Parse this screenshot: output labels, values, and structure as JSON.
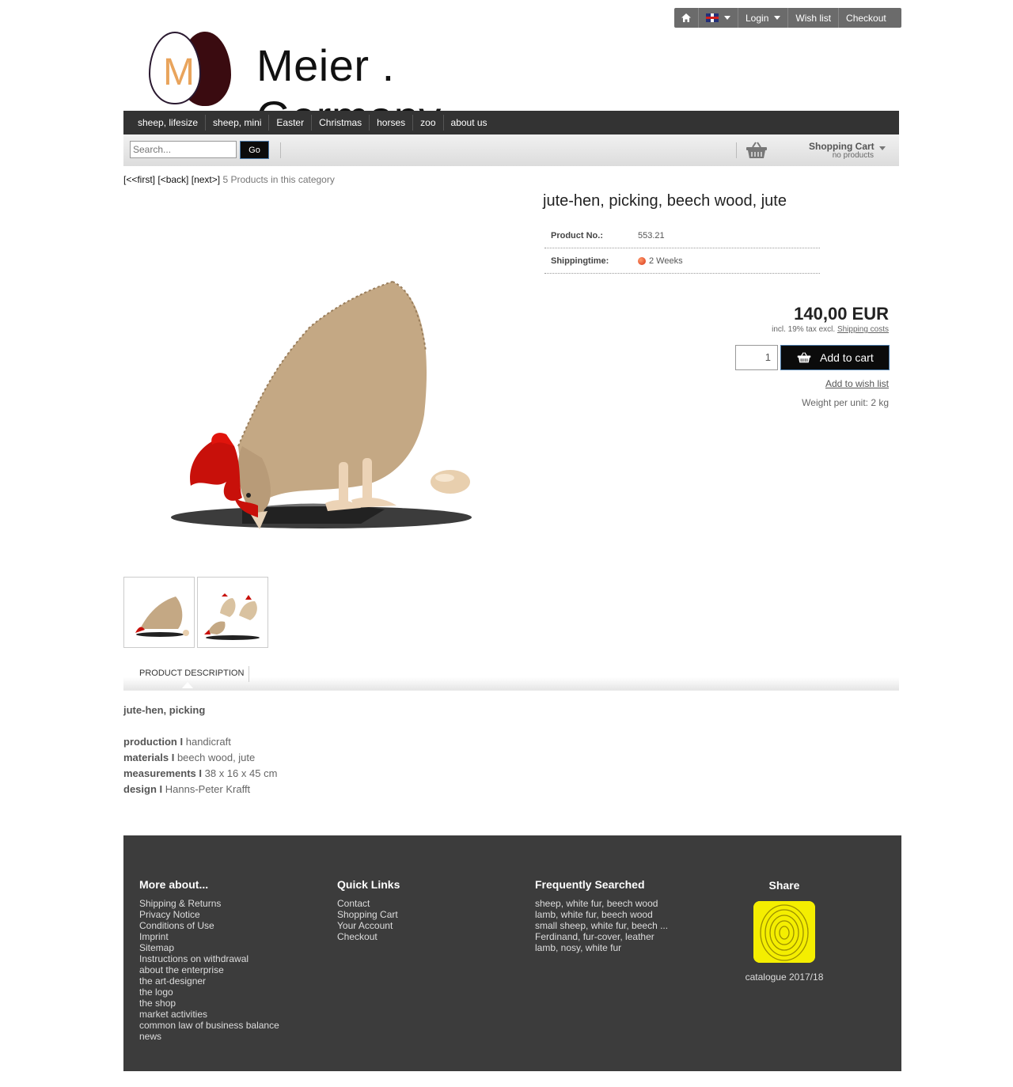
{
  "topbar": {
    "home_icon": "home-icon",
    "language_flag": "uk-flag-icon",
    "login": "Login",
    "wishlist": "Wish list",
    "checkout": "Checkout"
  },
  "logo": {
    "letter": "M",
    "text": "Meier . Germany"
  },
  "nav": [
    "sheep, lifesize",
    "sheep, mini",
    "Easter",
    "Christmas",
    "horses",
    "zoo",
    "about us"
  ],
  "search": {
    "placeholder": "Search...",
    "button": "Go"
  },
  "cart": {
    "title": "Shopping Cart",
    "status": "no products",
    "icon": "basket-icon"
  },
  "product_nav": {
    "first": "[<<first]",
    "back": "[<back]",
    "next": "[next>]",
    "count": "5 Products in this category"
  },
  "product": {
    "title": "jute-hen, picking, beech wood, jute",
    "number_label": "Product No.:",
    "number": "553.21",
    "shipping_label": "Shippingtime:",
    "shipping": "2 Weeks",
    "price": "140,00 EUR",
    "tax_text": "incl. 19% tax excl.",
    "shipping_costs": "Shipping costs",
    "quantity": "1",
    "add_to_cart": "Add to cart",
    "add_to_wishlist": "Add to wish list",
    "weight": "Weight per unit: 2 kg"
  },
  "tabs": {
    "description": "PRODUCT DESCRIPTION"
  },
  "description": {
    "headline": "jute-hen, picking",
    "rows": [
      {
        "label": "production I",
        "value": "handicraft"
      },
      {
        "label": "materials I",
        "value": "beech wood, jute"
      },
      {
        "label": "measurements I",
        "value": "38 x 16 x 45 cm"
      },
      {
        "label": "design I",
        "value": "Hanns-Peter Krafft"
      }
    ]
  },
  "footer": {
    "more_title": "More about...",
    "more_links": [
      "Shipping & Returns",
      "Privacy Notice",
      "Conditions of Use",
      "Imprint",
      "Sitemap",
      "Instructions on withdrawal",
      "about the enterprise",
      "the art-designer",
      "the logo",
      "the shop",
      "market activities",
      "common law of business balance",
      "news"
    ],
    "quick_title": "Quick Links",
    "quick_links": [
      "Contact",
      "Shopping Cart",
      "Your Account",
      "Checkout"
    ],
    "freq_title": "Frequently Searched",
    "freq_links": [
      "sheep, white fur, beech wood",
      "lamb, white fur, beech wood",
      "small sheep, white fur, beech ...",
      "Ferdinand, fur-cover, leather",
      "lamb, nosy, white fur"
    ],
    "share_title": "Share",
    "catalog_caption": "catalogue 2017/18"
  },
  "colors": {
    "nav_bg": "#333333",
    "button_bg": "#0b0b0b",
    "footer_bg": "#3c3c3c",
    "shipping_dot": "#d73418",
    "catalog_yellow": "#f4ee00"
  }
}
